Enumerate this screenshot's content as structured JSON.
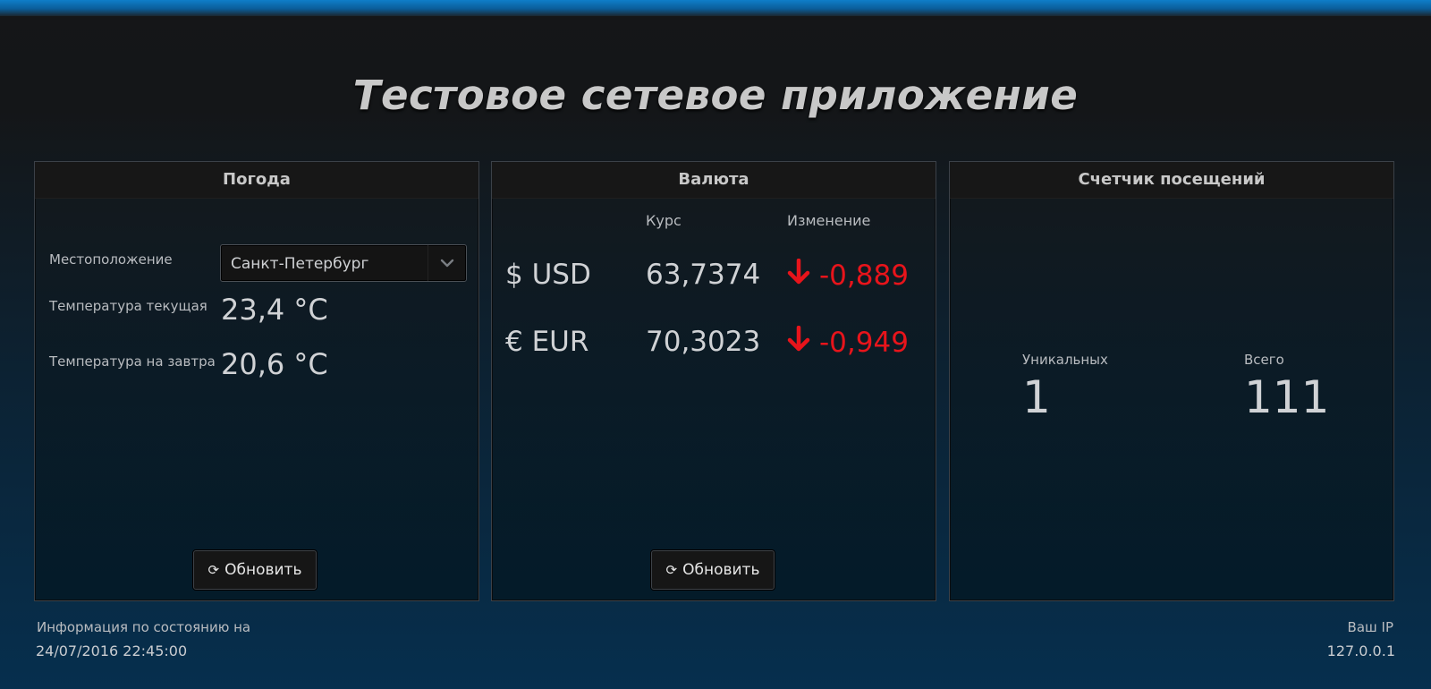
{
  "app": {
    "title": "Тестовое сетевое приложение"
  },
  "weather": {
    "header": "Погода",
    "location_label": "Местоположение",
    "location_value": "Санкт-Петербург",
    "temp_now_label": "Температура текущая",
    "temp_now_value": "23,4 °C",
    "temp_tomorrow_label": "Температура на завтра",
    "temp_tomorrow_value": "20,6 °C",
    "refresh_label": "Обновить",
    "refresh_icon": "refresh-icon"
  },
  "currency": {
    "header": "Валюта",
    "col_rate": "Курс",
    "col_change": "Изменение",
    "rows": [
      {
        "name": "$ USD",
        "rate": "63,7374",
        "change": "-0,889",
        "trend": "down"
      },
      {
        "name": "€ EUR",
        "rate": "70,3023",
        "change": "-0,949",
        "trend": "down"
      }
    ],
    "refresh_label": "Обновить",
    "down_color": "#e8141b"
  },
  "visits": {
    "header": "Счетчик посещений",
    "unique_label": "Уникальных",
    "unique_value": "1",
    "total_label": "Всего",
    "total_value": "111"
  },
  "footer": {
    "info_label": "Информация по состоянию на",
    "info_value": "24/07/2016 22:45:00",
    "ip_label": "Ваш IP",
    "ip_value": "127.0.0.1"
  },
  "colors": {
    "accent": "#0f7ec9",
    "down": "#e8141b"
  }
}
